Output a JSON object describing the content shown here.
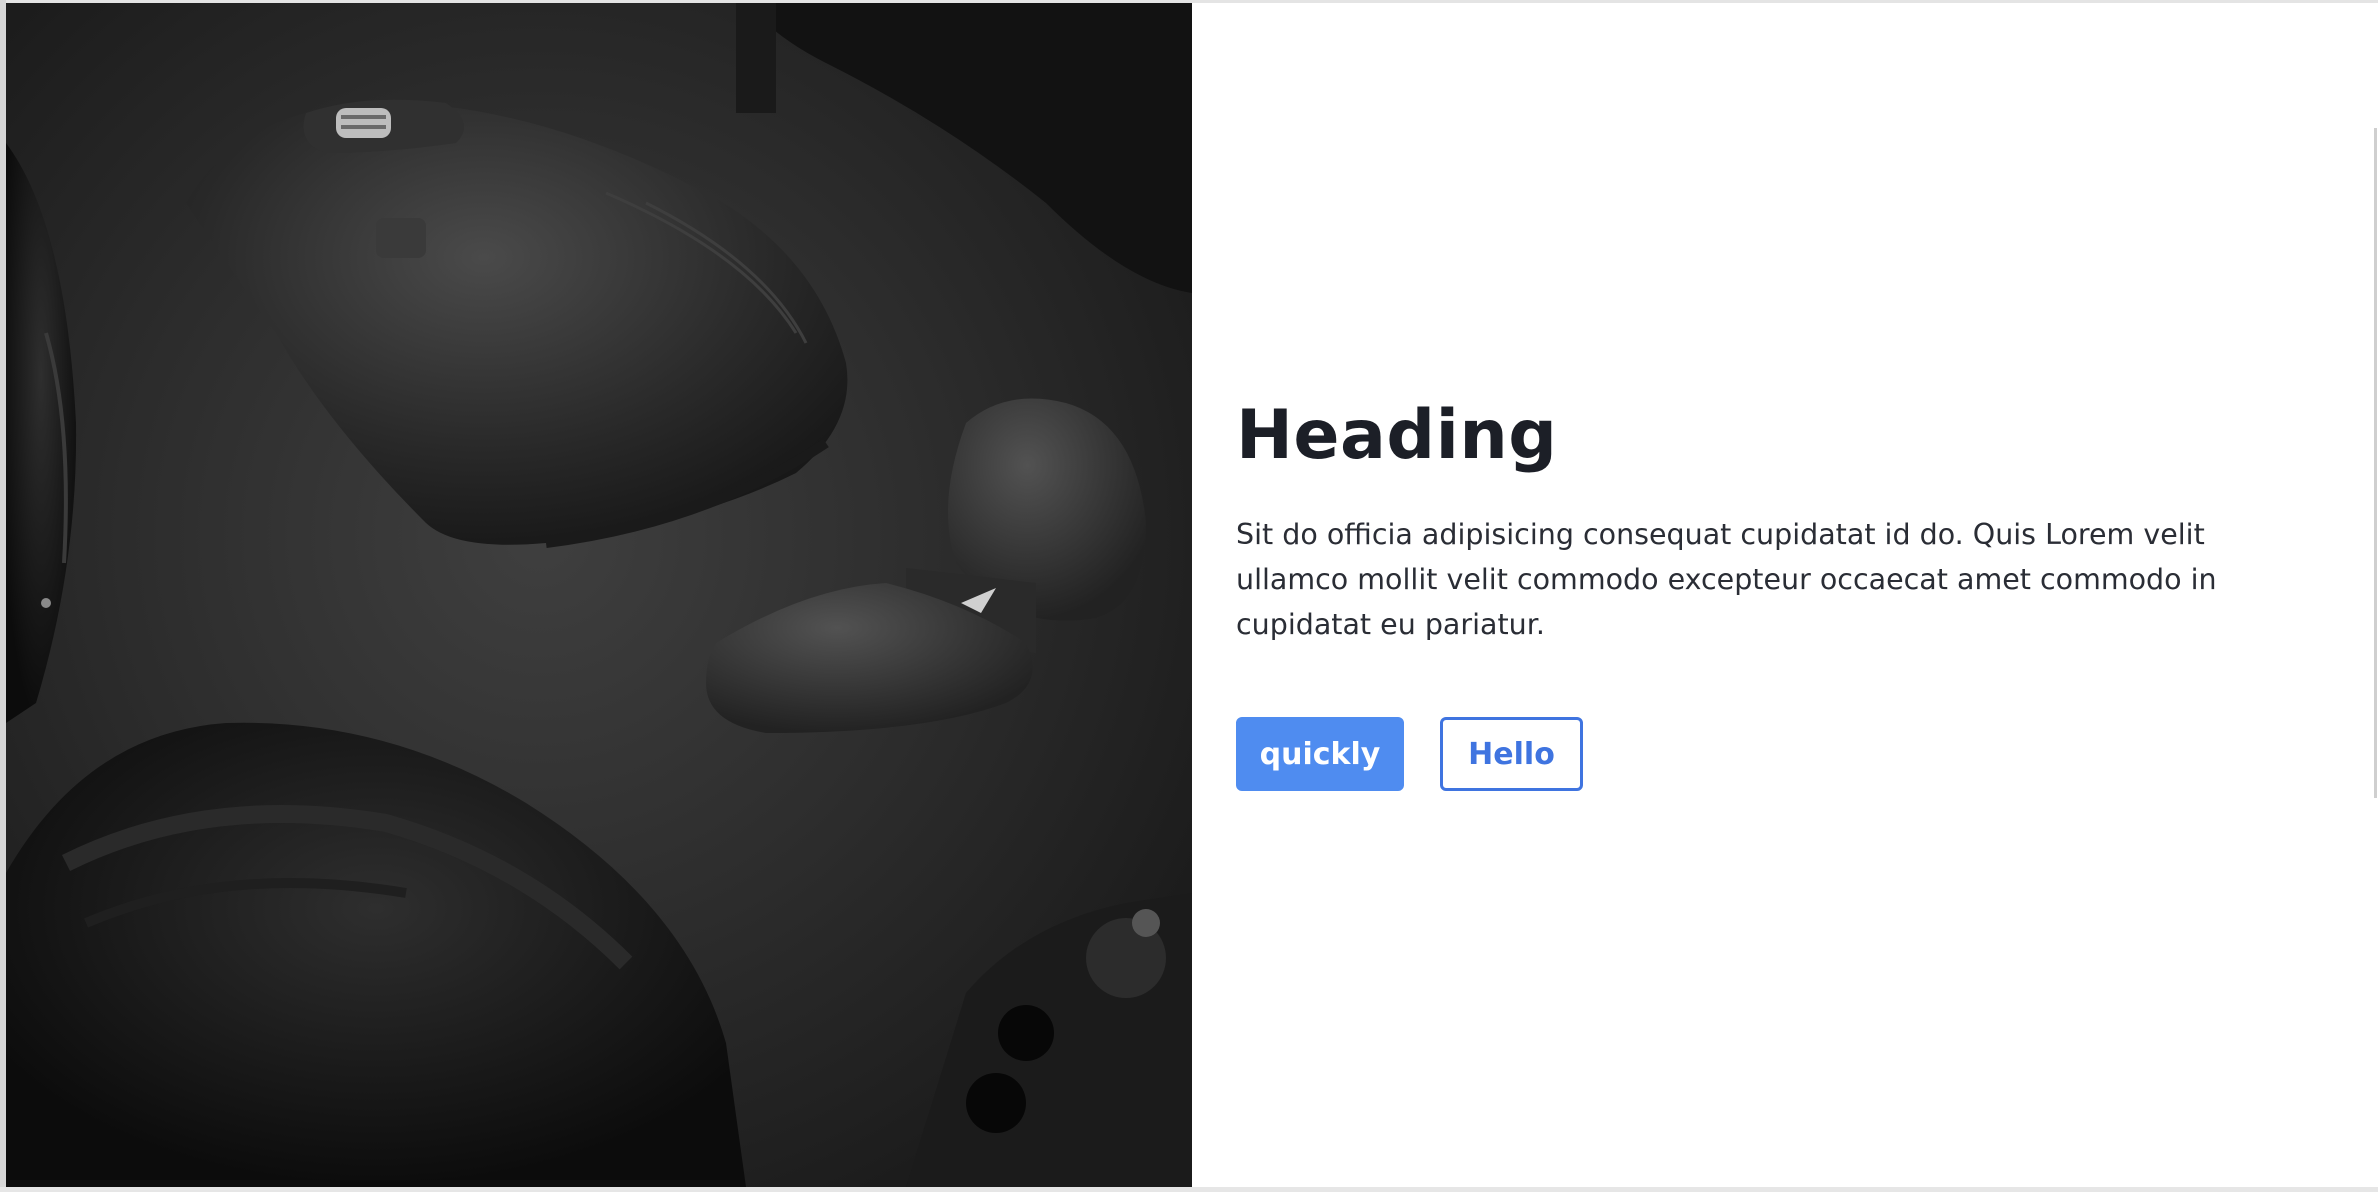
{
  "hero": {
    "image_subject": "mouse-and-camera-photo",
    "colors": {
      "background": "#2c2c2c",
      "object": "#1e1e1e"
    }
  },
  "content": {
    "heading": "Heading",
    "body": "Sit do officia adipisicing consequat cupidatat id do. Quis Lorem velit ullamco mollit velit commodo excepteur occaecat amet commodo in cupidatat eu pariatur.",
    "buttons": {
      "primary_label": "quickly",
      "secondary_label": "Hello"
    }
  },
  "colors": {
    "heading": "#1c1f27",
    "text": "#2a2d35",
    "accent": "#4f8cf0",
    "accent_outline": "#3f74e0"
  }
}
